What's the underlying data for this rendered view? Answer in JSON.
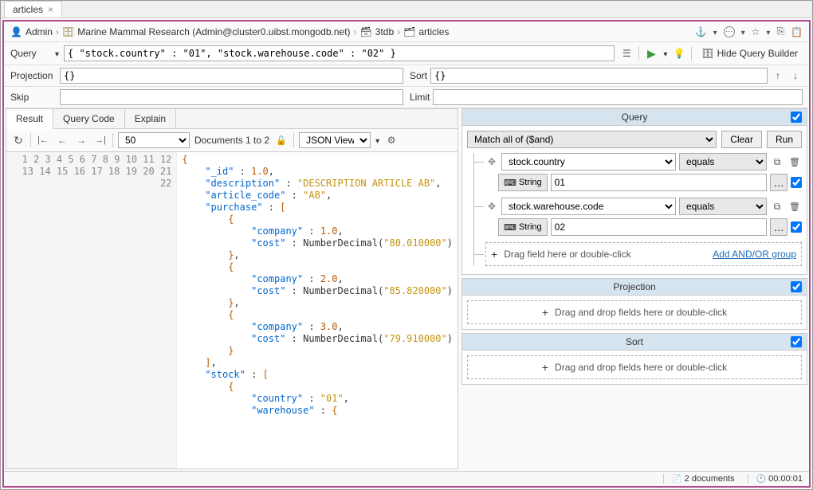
{
  "tab": {
    "title": "articles"
  },
  "breadcrumb": {
    "user": "Admin",
    "conn": "Marine Mammal Research (Admin@cluster0.uibst.mongodb.net)",
    "db": "3tdb",
    "coll": "articles"
  },
  "query": {
    "label": "Query",
    "value": "{ \"stock.country\" : \"01\", \"stock.warehouse.code\" : \"02\" }",
    "hide_builder": "Hide Query Builder"
  },
  "projection": {
    "label": "Projection",
    "value": "{}"
  },
  "sort": {
    "label": "Sort",
    "value": "{}"
  },
  "skip": {
    "label": "Skip",
    "value": ""
  },
  "limit": {
    "label": "Limit",
    "value": ""
  },
  "tabs2": {
    "result": "Result",
    "querycode": "Query Code",
    "explain": "Explain"
  },
  "toolbar": {
    "page_size": "50",
    "docs_label": "Documents 1 to 2",
    "view": "JSON View"
  },
  "builder": {
    "query_title": "Query",
    "match_mode": "Match all of ($and)",
    "clear": "Clear",
    "run": "Run",
    "conditions": [
      {
        "field": "stock.country",
        "op": "equals",
        "type": "String",
        "value": "01"
      },
      {
        "field": "stock.warehouse.code",
        "op": "equals",
        "type": "String",
        "value": "02"
      }
    ],
    "drop_field": "Drag field here or double-click",
    "add_group": "Add AND/OR group",
    "projection_title": "Projection",
    "proj_drop": "Drag and drop fields here or double-click",
    "sort_title": "Sort",
    "sort_drop": "Drag and drop fields here or double-click"
  },
  "status": {
    "doc_count": "2 documents",
    "elapsed": "00:00:01"
  },
  "result_json": {
    "_id": 1.0,
    "description": "DESCRIPTION ARTICLE AB",
    "article_code": "AB",
    "purchase": [
      {
        "company": 1.0,
        "cost": "NumberDecimal(\"80.010000\")"
      },
      {
        "company": 2.0,
        "cost": "NumberDecimal(\"85.820000\")"
      },
      {
        "company": 3.0,
        "cost": "NumberDecimal(\"79.910000\")"
      }
    ],
    "stock_first_country": "01"
  }
}
